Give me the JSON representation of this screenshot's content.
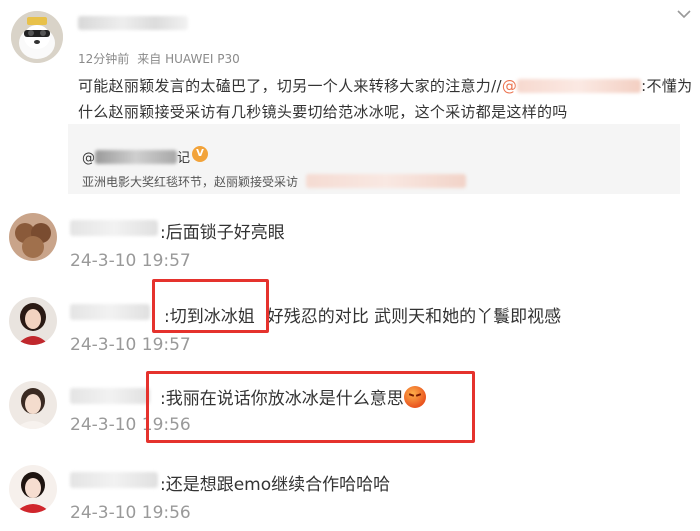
{
  "post": {
    "meta_time": "12分钟前",
    "meta_source": "来自 HUAWEI P30",
    "line1_a": "可能赵丽颖发言的太磕巴了，切另一个人来转移大家的注意力//",
    "line1_mention": "@",
    "line1_b": ":不懂为",
    "line2": "什么赵丽颖接受采访有几秒镜头要切给范冰冰呢，这个采访都是这样的吗"
  },
  "repost": {
    "author_prefix": "@",
    "author_suffix": "记",
    "badge": "V",
    "caption": "亚洲电影大奖红毯环节，赵丽颖接受采访"
  },
  "comments": [
    {
      "text": ":后面锁子好亮眼",
      "time": "24-3-10 19:57"
    },
    {
      "text_boxed": ":切到冰冰姐",
      "text_rest": "好残忍的对比 武则天和她的丫鬟即视感",
      "time": "24-3-10 19:57"
    },
    {
      "text": ":我丽在说话你放冰冰是什么意思",
      "emoji": "angry-face",
      "time": "24-3-10 19:56"
    },
    {
      "text": ":还是想跟emo继续合作哈哈哈",
      "time": "24-3-10 19:56"
    }
  ],
  "colors": {
    "highlight": "#e5322d",
    "mention": "#eb7350",
    "badge": "#f2a33a"
  }
}
